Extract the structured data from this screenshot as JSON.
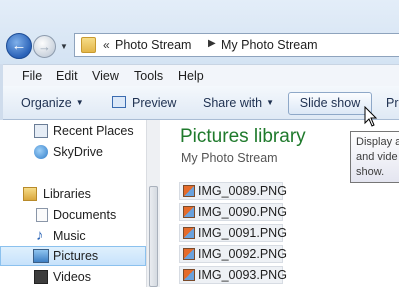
{
  "address": {
    "chevron": "«",
    "crumbs": [
      "Photo Stream",
      "My Photo Stream"
    ],
    "separator": "▶"
  },
  "nav_buttons": {
    "back": "←",
    "forward": "→",
    "dropdown": "▼"
  },
  "menu": [
    "File",
    "Edit",
    "View",
    "Tools",
    "Help"
  ],
  "toolbar": {
    "organize": "Organize",
    "preview": "Preview",
    "share_with": "Share with",
    "slide_show": "Slide show",
    "print_partial": "Pr",
    "dropdown_arrow": "▼"
  },
  "nav_pane": {
    "items": [
      {
        "label": "Recent Places",
        "icon": "recent-places-icon"
      },
      {
        "label": "SkyDrive",
        "icon": "skydrive-icon"
      },
      {
        "label": "Libraries",
        "icon": "libraries-icon"
      },
      {
        "label": "Documents",
        "icon": "documents-icon"
      },
      {
        "label": "Music",
        "icon": "music-icon"
      },
      {
        "label": "Pictures",
        "icon": "pictures-icon",
        "selected": true
      },
      {
        "label": "Videos",
        "icon": "videos-icon"
      }
    ]
  },
  "library": {
    "title": "Pictures library",
    "subtitle": "My Photo Stream",
    "files": [
      "IMG_0089.PNG",
      "IMG_0090.PNG",
      "IMG_0091.PNG",
      "IMG_0092.PNG",
      "IMG_0093.PNG"
    ]
  },
  "tooltip": {
    "lines": [
      "Display a",
      "and vide",
      "show."
    ]
  },
  "colors": {
    "library_title": "#1f7a2c",
    "selection": "#c7e2fb",
    "accent": "#2a62b8"
  }
}
